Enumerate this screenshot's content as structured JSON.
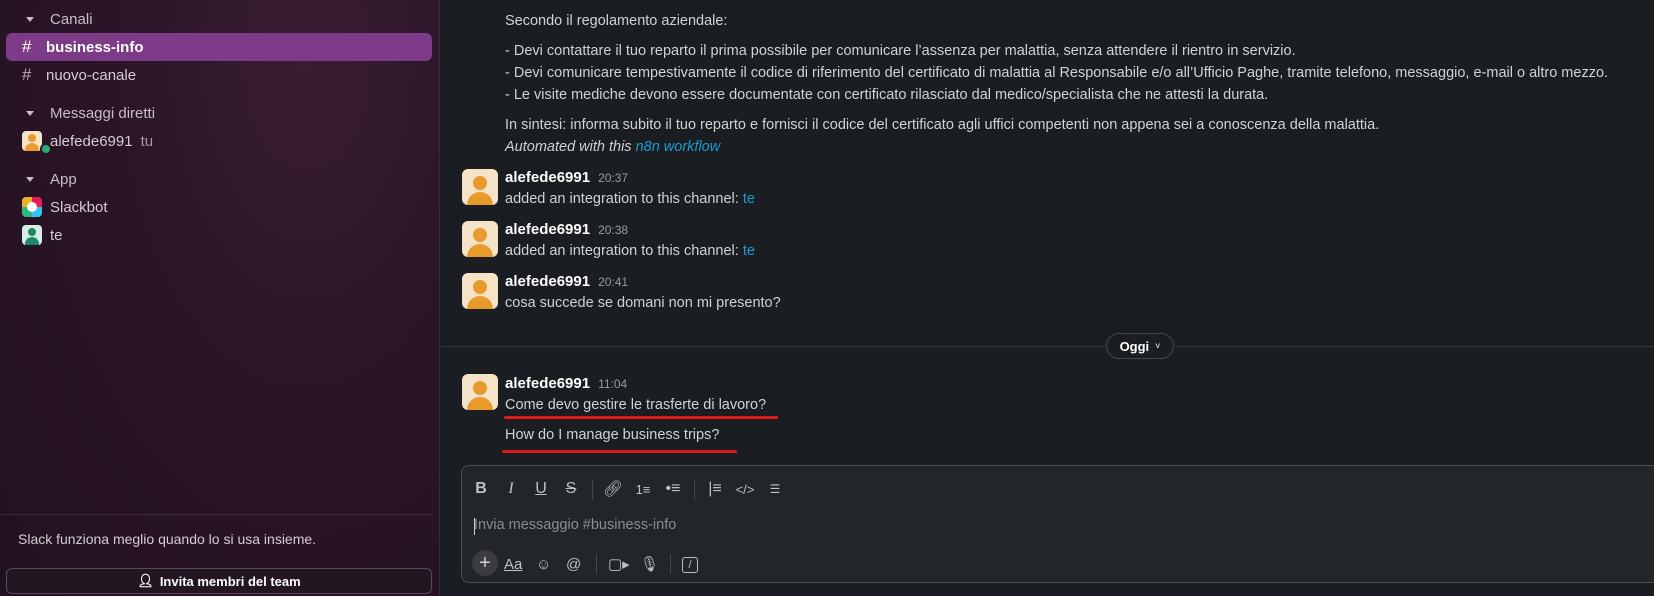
{
  "sidebar": {
    "channels_header": "Canali",
    "channels": [
      {
        "name": "business-info",
        "active": true
      },
      {
        "name": "nuovo-canale",
        "active": false
      }
    ],
    "dm_header": "Messaggi diretti",
    "dms": [
      {
        "name": "alefede6991",
        "suffix": "tu"
      }
    ],
    "apps_header": "App",
    "apps": [
      {
        "name": "Slackbot"
      },
      {
        "name": "te"
      }
    ],
    "promo_text": "Slack funziona meglio quando lo si usa insieme.",
    "invite_label": "Invita membri del team"
  },
  "messages": {
    "intro_line": "Secondo il regolamento aziendale:",
    "bullets": [
      "- Devi contattare il tuo reparto il prima possibile per comunicare l’assenza per malattia, senza attendere il rientro in servizio.",
      "- Devi comunicare tempestivamente il codice di riferimento del certificato di malattia al Responsabile e/o all’Ufficio Paghe, tramite telefono, messaggio, e-mail o altro mezzo.",
      "- Le visite mediche devono essere documentate con certificato rilasciato dal medico/specialista che ne attesti la durata."
    ],
    "summary": "In sintesi: informa subito il tuo reparto e fornisci il codice del certificato agli uffici competenti non appena sei a conoscenza della malattia.",
    "automated_prefix": "Automated with this ",
    "automated_link": "n8n workflow",
    "items": [
      {
        "user": "alefede6991",
        "time": "20:37",
        "text": "added an integration to this channel: ",
        "link": "te"
      },
      {
        "user": "alefede6991",
        "time": "20:38",
        "text": "added an integration to this channel: ",
        "link": "te"
      },
      {
        "user": "alefede6991",
        "time": "20:41",
        "text": "cosa succede se domani non mi presento?"
      }
    ],
    "day_divider": "Oggi",
    "last": {
      "user": "alefede6991",
      "time": "11:04",
      "text": "Come devo gestire le trasferte di lavoro?",
      "translation": "How do I manage business trips?"
    }
  },
  "composer": {
    "placeholder": "Invia messaggio #business-info",
    "format_tools": [
      "bold-icon",
      "italic-icon",
      "underline-icon",
      "strikethrough-icon",
      "link-icon",
      "ordered-list-icon",
      "bulleted-list-icon",
      "blockquote-icon",
      "code-icon",
      "code-block-icon"
    ],
    "bottom_tools": [
      "plus-icon",
      "format-text-icon",
      "emoji-icon",
      "mention-icon",
      "video-icon",
      "microphone-icon",
      "shortcuts-icon"
    ]
  },
  "colors": {
    "sidebar_active": "#7d3a86",
    "link": "#1d9bd1",
    "annotation_red": "#e01a1a"
  }
}
